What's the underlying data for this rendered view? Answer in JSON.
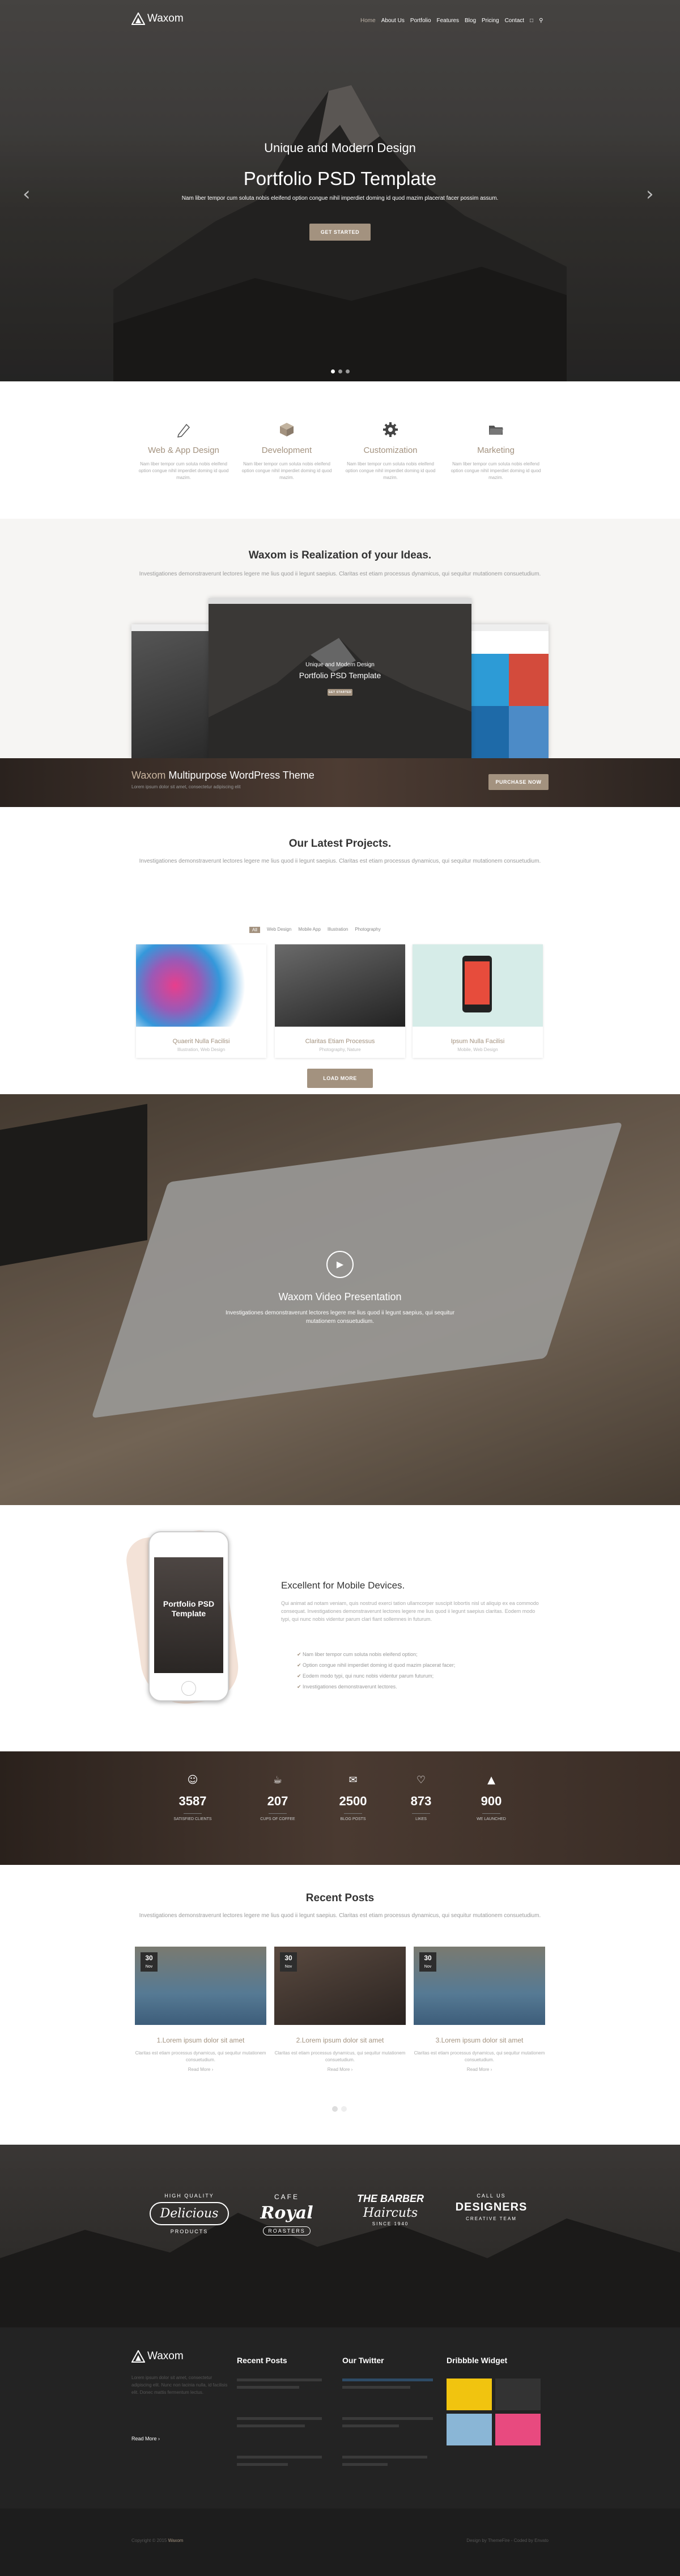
{
  "header": {
    "logo": "Waxom",
    "nav": [
      "Home",
      "About Us",
      "Portfolio",
      "Features",
      "Blog",
      "Pricing",
      "Contact"
    ]
  },
  "hero": {
    "subtitle": "Unique and Modern Design",
    "title": "Portfolio PSD Template",
    "text": "Nam liber tempor cum soluta nobis eleifend option congue nihil imperdiet doming id quod mazim placerat facer possim assum.",
    "button": "GET STARTED"
  },
  "services": [
    {
      "icon": "pen-icon",
      "title": "Web & App Design",
      "text": "Nam liber tempor cum soluta nobis eleifend option congue nihil imperdiet doming id quod mazim."
    },
    {
      "icon": "box-icon",
      "title": "Development",
      "text": "Nam liber tempor cum soluta nobis eleifend option congue nihil imperdiet doming id quod mazim."
    },
    {
      "icon": "gear-icon",
      "title": "Customization",
      "text": "Nam liber tempor cum soluta nobis eleifend option congue nihil imperdiet doming id quod mazim."
    },
    {
      "icon": "folder-icon",
      "title": "Marketing",
      "text": "Nam liber tempor cum soluta nobis eleifend option congue nihil imperdiet doming id quod mazim."
    }
  ],
  "realization": {
    "title_brand": "Waxom",
    "title_rest": " is Realization of your Ideas.",
    "text": "Investigationes demonstraverunt lectores legere me lius quod ii legunt saepius. Claritas est etiam processus dynamicus, qui sequitur mutationem consuetudium.",
    "mock_subtitle": "Unique and Modern Design",
    "mock_title": "Portfolio PSD Template",
    "mock_button": "GET STARTED"
  },
  "promo": {
    "brand": "Waxom",
    "title": " Multipurpose WordPress Theme",
    "text": "Lorem ipsum dolor sit amet, consectetur adipiscing elit",
    "button": "PURCHASE NOW"
  },
  "projects": {
    "title_brand": "Our",
    "title_rest": " Latest Projects.",
    "text": "Investigationes demonstraverunt lectores legere me lius quod ii legunt saepius. Claritas est etiam processus dynamicus, qui sequitur mutationem consuetudium.",
    "filters": [
      "All",
      "Web Design",
      "Mobile App",
      "Illustration",
      "Photography"
    ],
    "items": [
      {
        "title": "Quaerit Nulla Facilisi",
        "cat": "Illustration, Web Design"
      },
      {
        "title": "Claritas Etiam Processus",
        "cat": "Photography, Nature"
      },
      {
        "title": "Ipsum Nulla Facilisi",
        "cat": "Mobile, Web Design"
      }
    ],
    "button": "LOAD MORE"
  },
  "video": {
    "title_brand": "Waxom",
    "title_rest": " Video Presentation",
    "text": "Investigationes demonstraverunt lectores legere me lius quod ii legunt saepius, qui sequitur mutationem consuetudium."
  },
  "mobile": {
    "phone_title": "Portfolio PSD Template",
    "title_brand": "Excellent",
    "title_rest": " for Mobile Devices.",
    "text": "Qui animat ad notam veniam, quis nostrud exerci tation ullamcorper suscipit lobortis nisl ut aliquip ex ea commodo consequat. Investigationes demonstraverunt lectores legere me lius quod ii legunt saepius claritas. Eodem modo typi, qui nunc nobis videntur parum clari fiant sollemnes in futurum.",
    "list": [
      "Nam liber tempor cum soluta nobis eleifend option;",
      "Option congue nihil imperdiet doming id quod mazim placerat facer;",
      "Eodem modo typi, qui nunc nobis videntur parum futurum;",
      "Investigationes demonstraverunt lectores."
    ]
  },
  "counters": [
    {
      "icon": "user-icon",
      "n": "3587",
      "l": "SATISFIED CLIENTS"
    },
    {
      "icon": "coffee-icon",
      "n": "207",
      "l": "CUPS OF COFFEE"
    },
    {
      "icon": "chat-icon",
      "n": "2500",
      "l": "BLOG POSTS"
    },
    {
      "icon": "heart-icon",
      "n": "873",
      "l": "LIKES"
    },
    {
      "icon": "rocket-icon",
      "n": "900",
      "l": "WE LAUNCHED"
    }
  ],
  "posts": {
    "title_brand": "Recent",
    "title_rest": " Posts",
    "text": "Investigationes demonstraverunt lectores legere me lius quod ii legunt saepius. Claritas est etiam processus dynamicus, qui sequitur mutationem consuetudium.",
    "items": [
      {
        "day": "30",
        "mon": "Nov",
        "title": "1.Lorem ipsum dolor sit amet",
        "text": "Claritas est etiam processus dynamicus, qui sequitur mutationem consuetudium.",
        "more": "Read More"
      },
      {
        "day": "30",
        "mon": "Nov",
        "title": "2.Lorem ipsum dolor sit amet",
        "text": "Claritas est etiam processus dynamicus, qui sequitur mutationem consuetudium.",
        "more": "Read More"
      },
      {
        "day": "30",
        "mon": "Nov",
        "title": "3.Lorem ipsum dolor sit amet",
        "text": "Claritas est etiam processus dynamicus, qui sequitur mutationem consuetudium.",
        "more": "Read More"
      }
    ]
  },
  "clients": [
    {
      "top": "HIGH QUALITY",
      "main": "Delicious",
      "bottom": "PRODUCTS"
    },
    {
      "top": "CAFE",
      "main": "Royal",
      "bottom": "ROASTERS"
    },
    {
      "top": "THE BARBER",
      "main": "Haircuts",
      "bottom": "SINCE 1940"
    },
    {
      "top": "CALL US",
      "main": "DESIGNERS",
      "bottom": "CREATIVE TEAM"
    }
  ],
  "footer": {
    "logo": "Waxom",
    "about": "Lorem ipsum dolor sit amet, consectetur adipiscing elit. Nunc non lacinia nulla, id facilisis elit. Donec mattis fermentum lectus.",
    "readmore": "Read More",
    "recent_title": "Recent Posts",
    "twitter_title": "Our Twitter",
    "dribbble_title": "Dribbble Widget",
    "copyright": "Copyright © 2015",
    "copy_brand": "Waxom",
    "credit": "Design by ThemeFire - Coded by Envato"
  }
}
